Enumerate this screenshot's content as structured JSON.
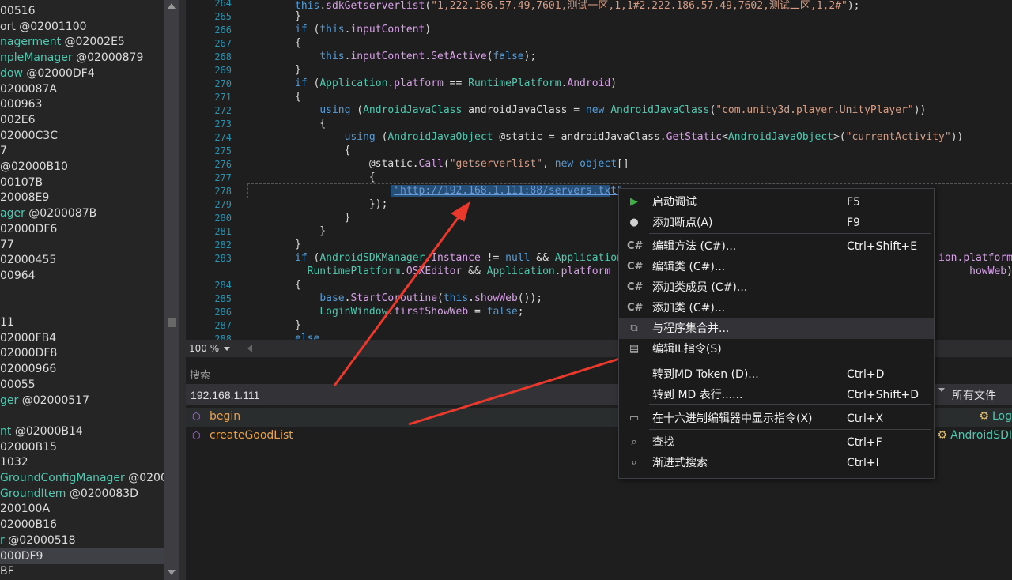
{
  "tree": {
    "rows": [
      {
        "prefix": "",
        "text": "00516"
      },
      {
        "prefix": "",
        "text": "ort @02001100"
      },
      {
        "prefix": "nagerment",
        "text": " @02002E5"
      },
      {
        "prefix": "npleManager",
        "text": " @02000879"
      },
      {
        "prefix": "dow",
        "text": " @02000DF4"
      },
      {
        "prefix": "",
        "text": "0200087A"
      },
      {
        "prefix": "",
        "text": "000963"
      },
      {
        "prefix": "",
        "text": "002E6"
      },
      {
        "prefix": "",
        "text": "02000C3C"
      },
      {
        "prefix": "",
        "text": "7"
      },
      {
        "prefix": "",
        "text": " @02000B10"
      },
      {
        "prefix": "",
        "text": "00107B"
      },
      {
        "prefix": "",
        "text": "20008E9"
      },
      {
        "prefix": "ager",
        "text": " @0200087B"
      },
      {
        "prefix": "",
        "text": "02000DF6"
      },
      {
        "prefix": "",
        "text": "77"
      },
      {
        "prefix": "",
        "text": "02000455"
      },
      {
        "prefix": "",
        "text": "00964"
      },
      {
        "prefix": "",
        "text": ""
      },
      {
        "prefix": "",
        "text": ""
      },
      {
        "prefix": "",
        "text": "11"
      },
      {
        "prefix": "",
        "text": "02000FB4"
      },
      {
        "prefix": "",
        "text": "02000DF8"
      },
      {
        "prefix": "",
        "text": "02000966"
      },
      {
        "prefix": "",
        "text": "00055"
      },
      {
        "prefix": "ger",
        "text": " @02000517"
      },
      {
        "prefix": "",
        "text": ""
      },
      {
        "prefix": "nt",
        "text": " @02000B14"
      },
      {
        "prefix": "",
        "text": "02000B15"
      },
      {
        "prefix": "",
        "text": "1032"
      },
      {
        "prefix": "GroundConfigManager",
        "text": " @0200"
      },
      {
        "prefix": "GroundItem",
        "text": " @0200083D"
      },
      {
        "prefix": "",
        "text": "200100A"
      },
      {
        "prefix": "",
        "text": "02000B16"
      },
      {
        "prefix": "r",
        "text": " @02000518"
      },
      {
        "prefix": "",
        "text": "000DF9"
      },
      {
        "prefix": "",
        "text": "BF"
      }
    ]
  },
  "editor": {
    "zoom": "100 %",
    "lines": [
      {
        "n": "264",
        "html": "<span class=\"kw\">this</span>.<span class=\"mt\">sdkGetserverlist</span>(<span class=\"st\">\"1,222.186.57.49,7601,测试一区,1,1#2,222.186.57.49,7602,测试二区,1,2#\"</span>);"
      },
      {
        "n": "265",
        "html": "}"
      },
      {
        "n": "266",
        "html": "<span class=\"kw\">if</span> (<span class=\"kw\">this</span>.<span class=\"pr\">inputContent</span>)"
      },
      {
        "n": "267",
        "html": "{"
      },
      {
        "n": "268",
        "html": "    <span class=\"kw\">this</span>.<span class=\"pr\">inputContent</span>.<span class=\"mt\">SetActive</span>(<span class=\"kw\">false</span>);"
      },
      {
        "n": "269",
        "html": "}"
      },
      {
        "n": "270",
        "html": "<span class=\"kw\">if</span> (<span class=\"ty\">Application</span>.<span class=\"pr\">platform</span> == <span class=\"ty\">RuntimePlatform</span>.<span class=\"pr\">Android</span>)"
      },
      {
        "n": "271",
        "html": "{"
      },
      {
        "n": "272",
        "html": "    <span class=\"kw\">using</span> (<span class=\"ty\">AndroidJavaClass</span> androidJavaClass = <span class=\"kw\">new</span> <span class=\"ty\">AndroidJavaClass</span>(<span class=\"st\">\"com.unity3d.player.UnityPlayer\"</span>))"
      },
      {
        "n": "273",
        "html": "    {"
      },
      {
        "n": "274",
        "html": "        <span class=\"kw\">using</span> (<span class=\"ty\">AndroidJavaObject</span> @static = androidJavaClass.<span class=\"mt\">GetStatic</span>&lt;<span class=\"ty\">AndroidJavaObject</span>&gt;(<span class=\"st\">\"currentActivity\"</span>))"
      },
      {
        "n": "275",
        "html": "        {"
      },
      {
        "n": "276",
        "html": "            @static.<span class=\"mt\">Call</span>(<span class=\"st\">\"getserverlist\"</span>, <span class=\"kw\">new</span> <span class=\"kw\">object</span>[]"
      },
      {
        "n": "277",
        "html": "            {"
      },
      {
        "n": "278",
        "html": "                <span class=\"url\">\"http://192.168.1.111:88/servers.txt\"</span>"
      },
      {
        "n": "279",
        "html": "            });"
      },
      {
        "n": "280",
        "html": "        }"
      },
      {
        "n": "281",
        "html": "    }"
      },
      {
        "n": "282",
        "html": "}"
      },
      {
        "n": "283",
        "html": "<span class=\"kw\">if</span> (<span class=\"ty\">AndroidSDKManager</span>.<span class=\"pr\">Instance</span> != <span class=\"kw\">null</span> &amp;&amp; <span class=\"ty\">Application</span>.                                                  <span class=\"pr\">ion.platform</span>"
      },
      {
        "n": "",
        "html": "  <span class=\"ty\">RuntimePlatform</span>.<span class=\"pr\">OSXEditor</span> &amp;&amp; <span class=\"ty\">Application</span>.<span class=\"pr\">platform</span> !=                                                       <span class=\"pr\">howWeb</span>)"
      },
      {
        "n": "284",
        "html": "{"
      },
      {
        "n": "285",
        "html": "    <span class=\"kw\">base</span>.<span class=\"mt\">StartCoroutine</span>(<span class=\"kw\">this</span>.<span class=\"mt\">showWeb</span>());"
      },
      {
        "n": "286",
        "html": "    <span class=\"ty\">LoginWindow</span>.<span class=\"pr\">firstShowWeb</span> = <span class=\"kw\">false</span>;"
      },
      {
        "n": "287",
        "html": "}"
      },
      {
        "n": "288",
        "html": "<span class=\"kw\">else</span>"
      }
    ]
  },
  "search": {
    "title": "搜索",
    "query": "192.168.1.111",
    "filter": "所有文件",
    "results": [
      {
        "name": "begin",
        "location": "Log"
      },
      {
        "name": "createGoodList",
        "location": "AndroidSDI"
      }
    ]
  },
  "menu": {
    "items": [
      {
        "icon": "play-icon",
        "glyph": "▶",
        "label": "启动调试",
        "shortcut": "F5"
      },
      {
        "icon": "breakpoint-icon",
        "glyph": "●",
        "label": "添加断点(A)",
        "shortcut": "F9"
      },
      {
        "icon": "csharp-icon",
        "glyph": "C#",
        "label": "编辑方法 (C#)...",
        "shortcut": "Ctrl+Shift+E"
      },
      {
        "icon": "csharp-icon",
        "glyph": "C#",
        "label": "编辑类 (C#)...",
        "shortcut": ""
      },
      {
        "icon": "csharp-icon",
        "glyph": "C#",
        "label": "添加类成员 (C#)...",
        "shortcut": ""
      },
      {
        "icon": "csharp-icon",
        "glyph": "C#",
        "label": "添加类 (C#)...",
        "shortcut": ""
      },
      {
        "icon": "merge-icon",
        "glyph": "⧉",
        "label": "与程序集合并...",
        "shortcut": ""
      },
      {
        "icon": "il-icon",
        "glyph": "▤",
        "label": "编辑IL指令(S)",
        "shortcut": ""
      },
      {
        "icon": "",
        "glyph": "",
        "label": "转到MD Token (D)...",
        "shortcut": "Ctrl+D"
      },
      {
        "icon": "",
        "glyph": "",
        "label": "转到 MD 表行......",
        "shortcut": "Ctrl+Shift+D"
      },
      {
        "icon": "hex-icon",
        "glyph": "▭",
        "label": "在十六进制编辑器中显示指令(X)",
        "shortcut": "Ctrl+X"
      },
      {
        "icon": "search-icon",
        "glyph": "⌕",
        "label": "查找",
        "shortcut": "Ctrl+F"
      },
      {
        "icon": "search-icon",
        "glyph": "⌕",
        "label": "渐进式搜索",
        "shortcut": "Ctrl+I"
      }
    ]
  },
  "colors": {
    "play": "#3cb043",
    "accent_arrow": "#e8392c"
  }
}
